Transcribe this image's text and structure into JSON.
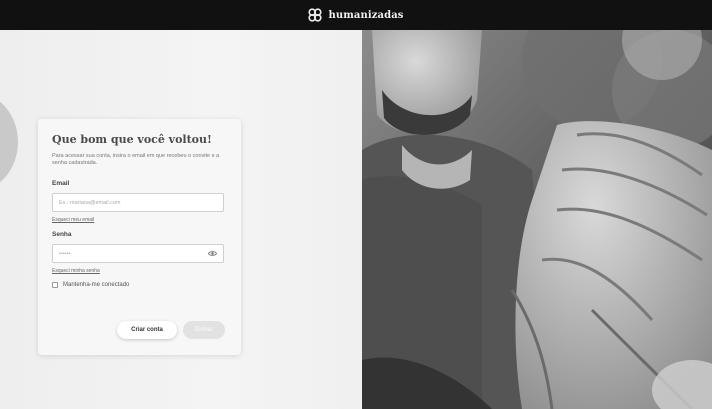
{
  "header": {
    "brand_name": "humanizadas",
    "brand_icon": "infinity-logo-icon"
  },
  "login": {
    "title": "Que bom que você voltou!",
    "subtitle": "Para acessar sua conta, insira o email em que recebeu o convite e a senha cadastrada.",
    "email_label": "Email",
    "email_placeholder": "Ex.: mariana@email.com",
    "email_value": "",
    "forgot_email": "Esqueci meu email",
    "password_label": "Senha",
    "password_placeholder": "••••••",
    "password_value": "",
    "forgot_password": "Esqueci minha senha",
    "remember_label": "Mantenha-me conectado",
    "remember_checked": false,
    "create_account": "Criar conta",
    "submit": "Entrar"
  },
  "photo": {
    "subject": "group-hands-together-photo"
  },
  "colors": {
    "topbar": "#111111",
    "background": "#f2f2f2",
    "card": "#f7f7f7",
    "primary_disabled": "#e2e2e2"
  }
}
